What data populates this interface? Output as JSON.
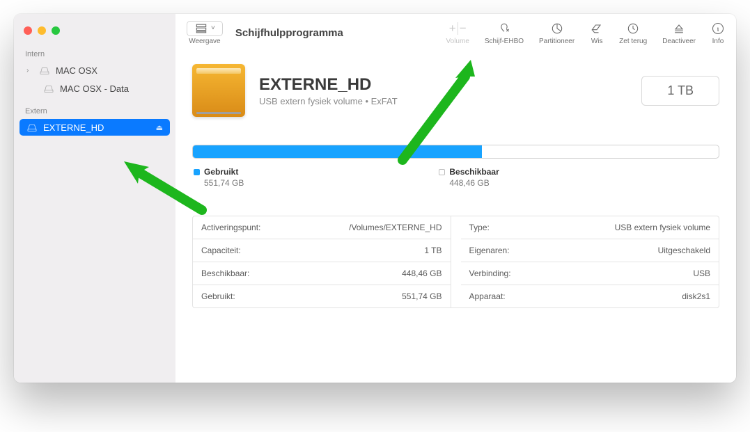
{
  "app": {
    "title": "Schijfhulpprogramma",
    "view_label": "Weergave"
  },
  "toolbar": {
    "volume": "Volume",
    "firstaid": "Schijf-EHBO",
    "partition": "Partitioneer",
    "erase": "Wis",
    "restore": "Zet terug",
    "unmount": "Deactiveer",
    "info": "Info"
  },
  "sidebar": {
    "internal_label": "Intern",
    "external_label": "Extern",
    "internal": [
      {
        "name": "MAC OSX"
      },
      {
        "name": "MAC OSX - Data"
      }
    ],
    "external": [
      {
        "name": "EXTERNE_HD"
      }
    ]
  },
  "volume": {
    "name": "EXTERNE_HD",
    "subtitle": "USB extern fysiek volume • ExFAT",
    "capacity": "1 TB"
  },
  "usage": {
    "used_label": "Gebruikt",
    "used_value": "551,74 GB",
    "free_label": "Beschikbaar",
    "free_value": "448,46 GB",
    "used_pct": 55
  },
  "info": {
    "left": [
      {
        "k": "Activeringspunt:",
        "v": "/Volumes/EXTERNE_HD"
      },
      {
        "k": "Capaciteit:",
        "v": "1 TB"
      },
      {
        "k": "Beschikbaar:",
        "v": "448,46 GB"
      },
      {
        "k": "Gebruikt:",
        "v": "551,74 GB"
      }
    ],
    "right": [
      {
        "k": "Type:",
        "v": "USB extern fysiek volume"
      },
      {
        "k": "Eigenaren:",
        "v": "Uitgeschakeld"
      },
      {
        "k": "Verbinding:",
        "v": "USB"
      },
      {
        "k": "Apparaat:",
        "v": "disk2s1"
      }
    ]
  }
}
